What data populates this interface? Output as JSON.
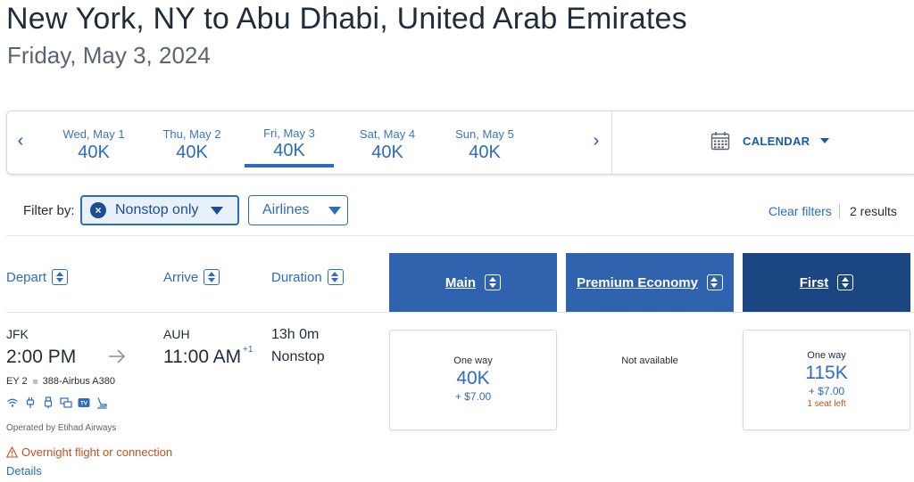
{
  "header": {
    "route": "New York, NY to Abu Dhabi, United Arab Emirates",
    "date": "Friday, May 3, 2024"
  },
  "date_strip": {
    "prev": "‹",
    "next": "›",
    "days": [
      {
        "label": "Wed, May 1",
        "points": "40K"
      },
      {
        "label": "Thu, May 2",
        "points": "40K"
      },
      {
        "label": "Fri, May 3",
        "points": "40K",
        "selected": true
      },
      {
        "label": "Sat, May 4",
        "points": "40K"
      },
      {
        "label": "Sun, May 5",
        "points": "40K"
      }
    ],
    "calendar_label": "CALENDAR"
  },
  "filters": {
    "label": "Filter by:",
    "nonstop_chip": "Nonstop only",
    "remove_icon": "×",
    "airlines_chip": "Airlines",
    "clear": "Clear filters",
    "results": "2 results"
  },
  "columns": {
    "depart": "Depart",
    "arrive": "Arrive",
    "duration": "Duration",
    "cabins": [
      "Main",
      "Premium Economy",
      "First"
    ]
  },
  "flight": {
    "origin": "JFK",
    "depart_time": "2:00 PM",
    "destination": "AUH",
    "arrive_time": "11:00 AM",
    "day_offset": "+1",
    "duration": "13h 0m",
    "stops": "Nonstop",
    "flight_number": "EY 2",
    "aircraft": "388-Airbus A380",
    "amenities": [
      "wifi-icon",
      "power-icon",
      "usb-icon",
      "entertainment-icon",
      "tv-icon",
      "lie-flat-seat-icon"
    ],
    "tv_badge": "TV",
    "operated_by": "Operated by Etihad Airways",
    "overnight": "Overnight flight or connection",
    "details": "Details",
    "fares": {
      "main": {
        "label": "One way",
        "points": "40K",
        "taxes": "+ $7.00"
      },
      "premium": {
        "label": "Not available"
      },
      "first": {
        "label": "One way",
        "points": "115K",
        "taxes": "+ $7.00",
        "seats": "1 seat left"
      }
    }
  },
  "colors": {
    "accent": "#2d6cc0",
    "cabin_header": "#2f63ad",
    "first_header": "#1c4682",
    "warning": "#c4511b"
  }
}
